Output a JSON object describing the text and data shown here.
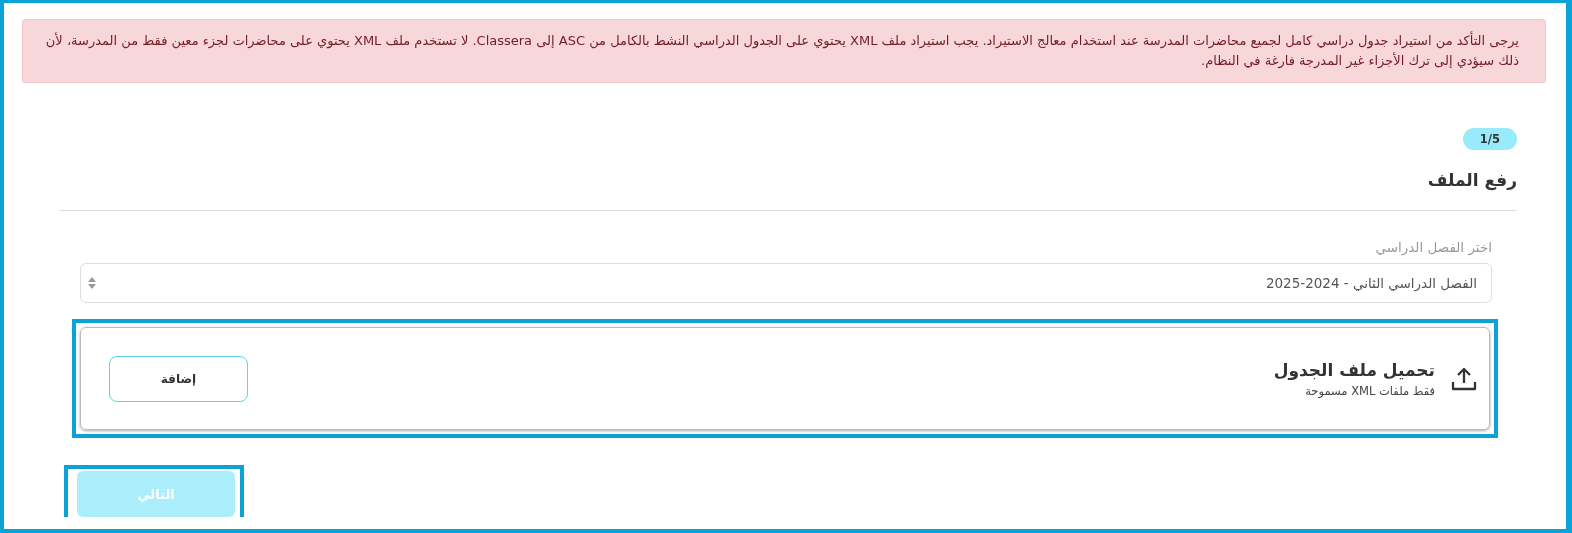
{
  "alert": {
    "text": "يرجى التأكد من استيراد جدول دراسي كامل لجميع محاضرات المدرسة عند استخدام معالج الاستيراد. يجب استيراد ملف XML يحتوي على الجدول الدراسي النشط بالكامل من ASC إلى Classera. لا تستخدم ملف XML يحتوي على محاضرات لجزء معين فقط من المدرسة، لأن ذلك سيؤدي إلى ترك الأجزاء غير المدرجة فارغة في النظام."
  },
  "step_badge": "1/5",
  "section_title": "رفع الملف",
  "term_select": {
    "label": "اختر الفصل الدراسي",
    "value": "الفصل الدراسي الثاني - 2024-2025"
  },
  "upload": {
    "title": "تحميل ملف الجدول",
    "hint": "فقط ملفات XML مسموحة",
    "button": "إضافة",
    "focused": true
  },
  "next_button": {
    "label": "التالي",
    "disabled": true,
    "focused": true
  }
}
